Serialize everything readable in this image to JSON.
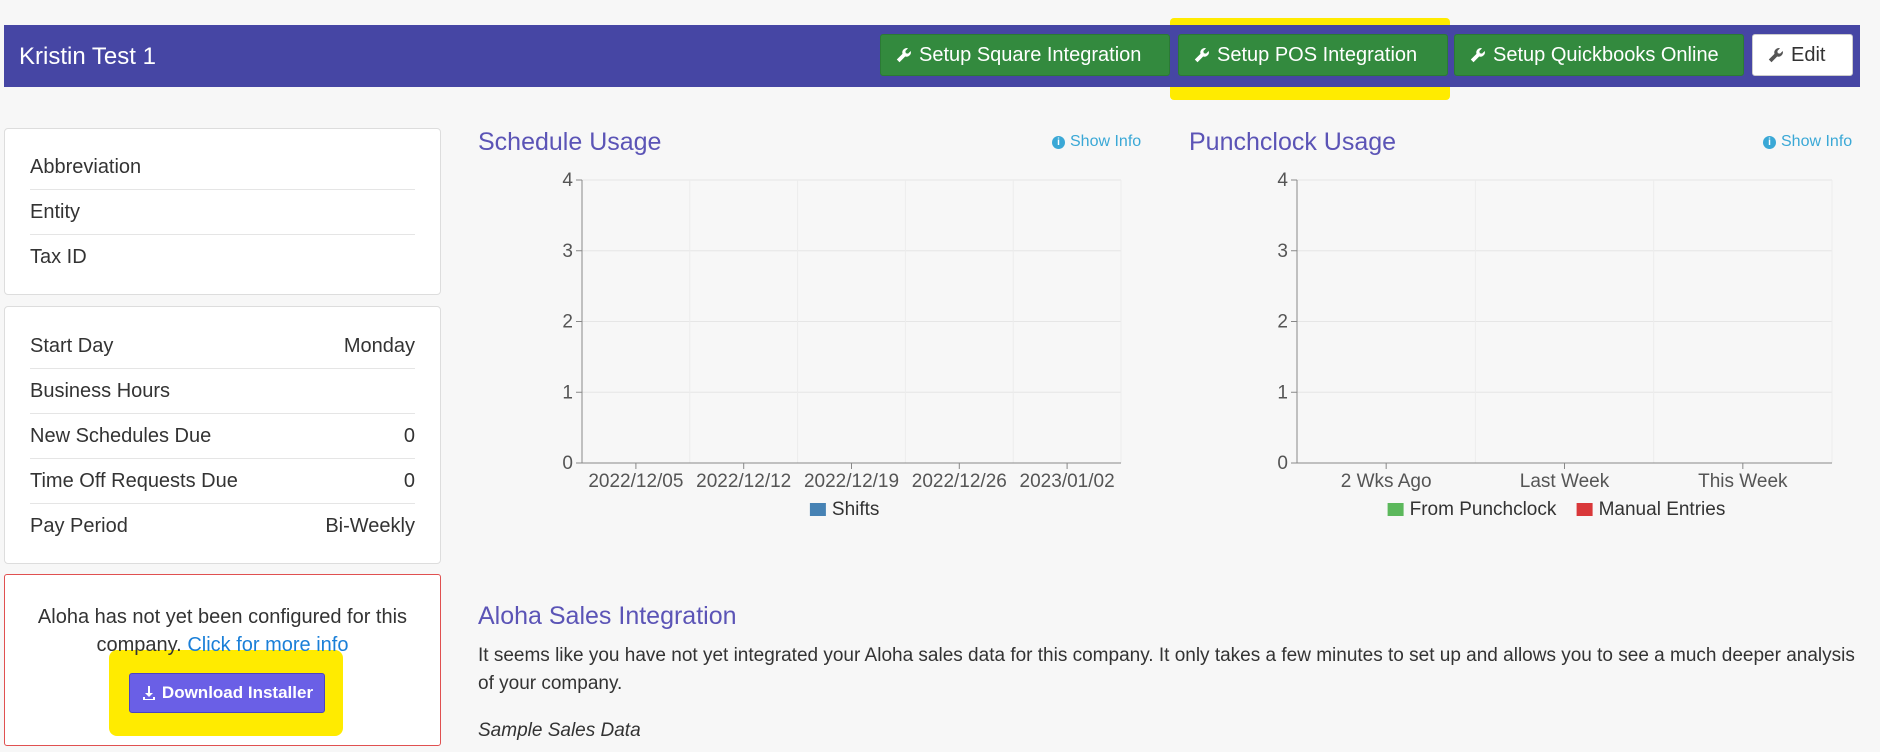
{
  "header": {
    "title": "Kristin Test 1",
    "buttons": {
      "square": "Setup Square Integration",
      "pos": "Setup POS Integration",
      "quickbooks": "Setup Quickbooks Online",
      "edit": "Edit"
    }
  },
  "company_info": [
    {
      "label": "Abbreviation",
      "value": ""
    },
    {
      "label": "Entity",
      "value": ""
    },
    {
      "label": "Tax ID",
      "value": ""
    }
  ],
  "schedule_settings": [
    {
      "label": "Start Day",
      "value": "Monday"
    },
    {
      "label": "Business Hours",
      "value": ""
    },
    {
      "label": "New Schedules Due",
      "value": "0"
    },
    {
      "label": "Time Off Requests Due",
      "value": "0"
    },
    {
      "label": "Pay Period",
      "value": "Bi-Weekly"
    }
  ],
  "aloha_alert": {
    "line1": "Aloha has not yet been configured for this",
    "line2": "company.",
    "link": "Click for more info",
    "download_button": "Download Installer"
  },
  "show_info_label": "Show Info",
  "chart_data": [
    {
      "type": "bar",
      "title": "Schedule Usage",
      "categories": [
        "2022/12/05",
        "2022/12/12",
        "2022/12/19",
        "2022/12/26",
        "2023/01/02"
      ],
      "series": [
        {
          "name": "Shifts",
          "values": [
            0,
            0,
            0,
            0,
            0
          ],
          "color": "#4682b4"
        }
      ],
      "yticks": [
        0,
        1,
        2,
        3,
        4
      ],
      "ylim": [
        0,
        4
      ],
      "grid": true,
      "legend": "bottom"
    },
    {
      "type": "bar",
      "title": "Punchclock Usage",
      "categories": [
        "2 Wks Ago",
        "Last Week",
        "This Week"
      ],
      "series": [
        {
          "name": "From Punchclock",
          "values": [
            0,
            0,
            0
          ],
          "color": "#5cb85c"
        },
        {
          "name": "Manual Entries",
          "values": [
            0,
            0,
            0
          ],
          "color": "#d9383a"
        }
      ],
      "yticks": [
        0,
        1,
        2,
        3,
        4
      ],
      "ylim": [
        0,
        4
      ],
      "grid": true,
      "legend": "bottom"
    }
  ],
  "aloha_section": {
    "title": "Aloha Sales Integration",
    "paragraph": "It seems like you have not yet integrated your Aloha sales data for this company. It only takes a few minutes to set up and allows you to see a much deeper analysis of your company.",
    "sample_heading": "Sample Sales Data"
  },
  "colors": {
    "header_bg": "#4646a4",
    "accent_green": "#338a3e",
    "title_purple": "#5b54b6",
    "highlight": "#ffeb00"
  }
}
